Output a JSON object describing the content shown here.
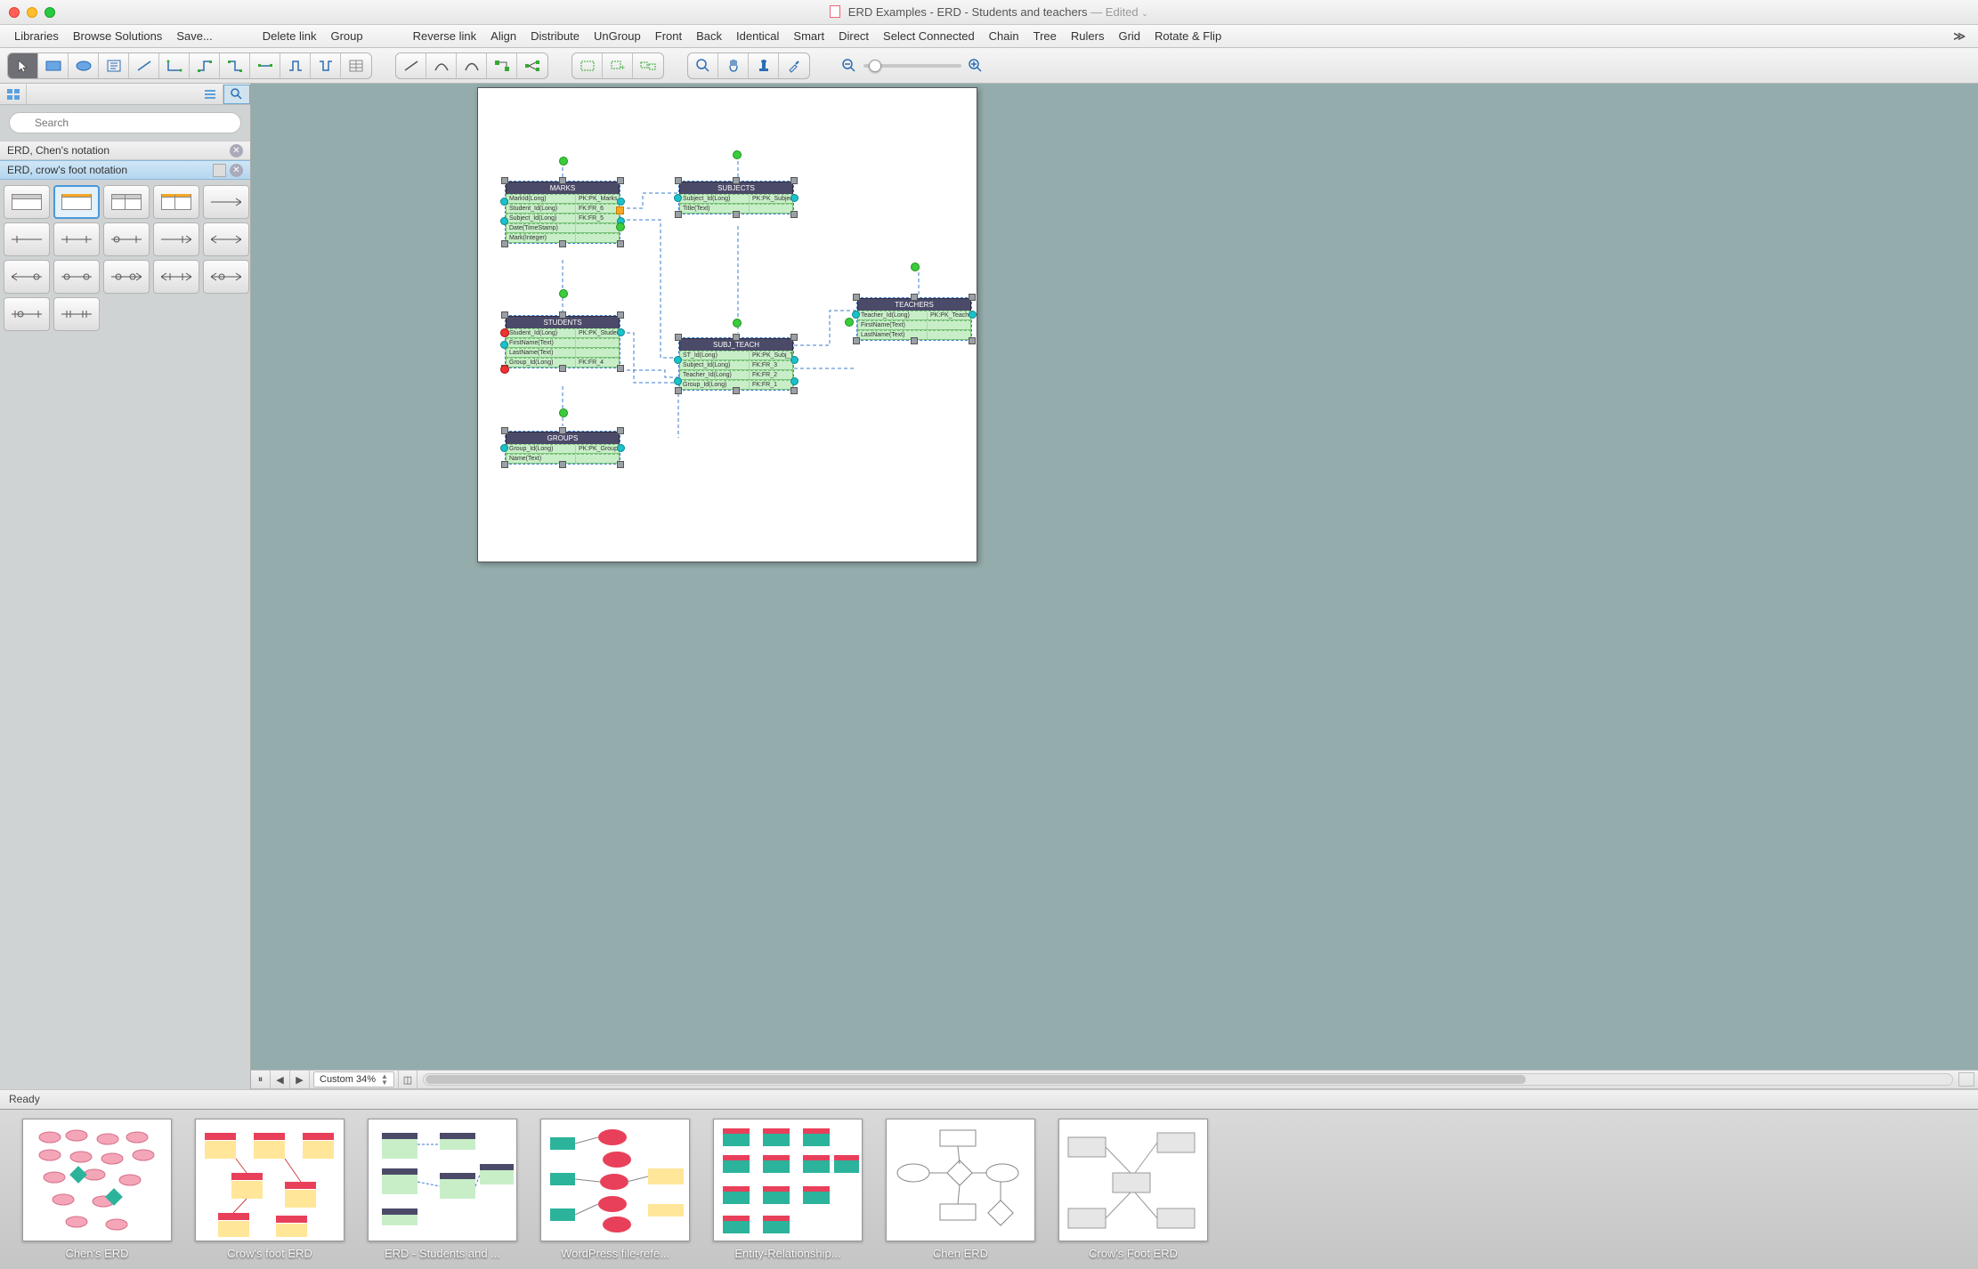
{
  "window": {
    "title_prefix": "ERD Examples - ERD - Students and teachers",
    "edited_suffix": " — Edited"
  },
  "menu": {
    "left": [
      "Libraries",
      "Browse Solutions",
      "Save..."
    ],
    "mid": [
      "Delete link",
      "Group"
    ],
    "right": [
      "Reverse link",
      "Align",
      "Distribute",
      "UnGroup",
      "Front",
      "Back",
      "Identical",
      "Smart",
      "Direct",
      "Select Connected",
      "Chain",
      "Tree",
      "Rulers",
      "Grid",
      "Rotate & Flip"
    ]
  },
  "sidebar": {
    "search_placeholder": "Search",
    "libs": [
      {
        "name": "ERD, Chen's notation",
        "selected": false
      },
      {
        "name": "ERD, crow's foot notation",
        "selected": true
      }
    ]
  },
  "canvas": {
    "zoom_label": "Custom 34%",
    "entities": {
      "marks": {
        "title": "MARKS",
        "rows": [
          [
            "MarkId(Long)",
            "PK:PK_Marks"
          ],
          [
            "Student_Id(Long)",
            "FK:FR_6"
          ],
          [
            "Subject_Id(Long)",
            "FK:FR_5"
          ],
          [
            "Date(TimeStamp)",
            ""
          ],
          [
            "Mark(Integer)",
            ""
          ]
        ]
      },
      "subjects": {
        "title": "SUBJECTS",
        "rows": [
          [
            "Subject_Id(Long)",
            "PK:PK_Subjects"
          ],
          [
            "Title(Text)",
            ""
          ]
        ]
      },
      "students": {
        "title": "STUDENTS",
        "rows": [
          [
            "Student_Id(Long)",
            "PK:PK_Students"
          ],
          [
            "FirstName(Text)",
            ""
          ],
          [
            "LastName(Text)",
            ""
          ],
          [
            "Group_Id(Long)",
            "FK:FR_4"
          ]
        ]
      },
      "teachers": {
        "title": "TEACHERS",
        "rows": [
          [
            "Teacher_Id(Long)",
            "PK:PK_Teachers"
          ],
          [
            "FirstName(Text)",
            ""
          ],
          [
            "LastName(Text)",
            ""
          ]
        ]
      },
      "subj_teach": {
        "title": "SUBJ_TEACH",
        "rows": [
          [
            "ST_Id(Long)",
            "PK:PK_Subj_Teach"
          ],
          [
            "Subject_Id(Long)",
            "FK:FR_3"
          ],
          [
            "Teacher_Id(Long)",
            "FK:FR_2"
          ],
          [
            "Group_Id(Long)",
            "FK:FR_1"
          ]
        ]
      },
      "groups": {
        "title": "GROUPS",
        "rows": [
          [
            "Group_Id(Long)",
            "PK:PK_Groups"
          ],
          [
            "Name(Text)",
            ""
          ]
        ]
      }
    }
  },
  "status": {
    "text": "Ready"
  },
  "gallery": [
    "Chen's ERD",
    "Crow's foot ERD",
    "ERD - Students and ...",
    "WordPress file-refe...",
    "Entity-Relationship...",
    "Chen ERD",
    "Crow's Foot ERD"
  ],
  "colors": {
    "accent": "#4a98d8",
    "entity_header": "#4b4a68",
    "entity_row": "#c8eec8"
  }
}
